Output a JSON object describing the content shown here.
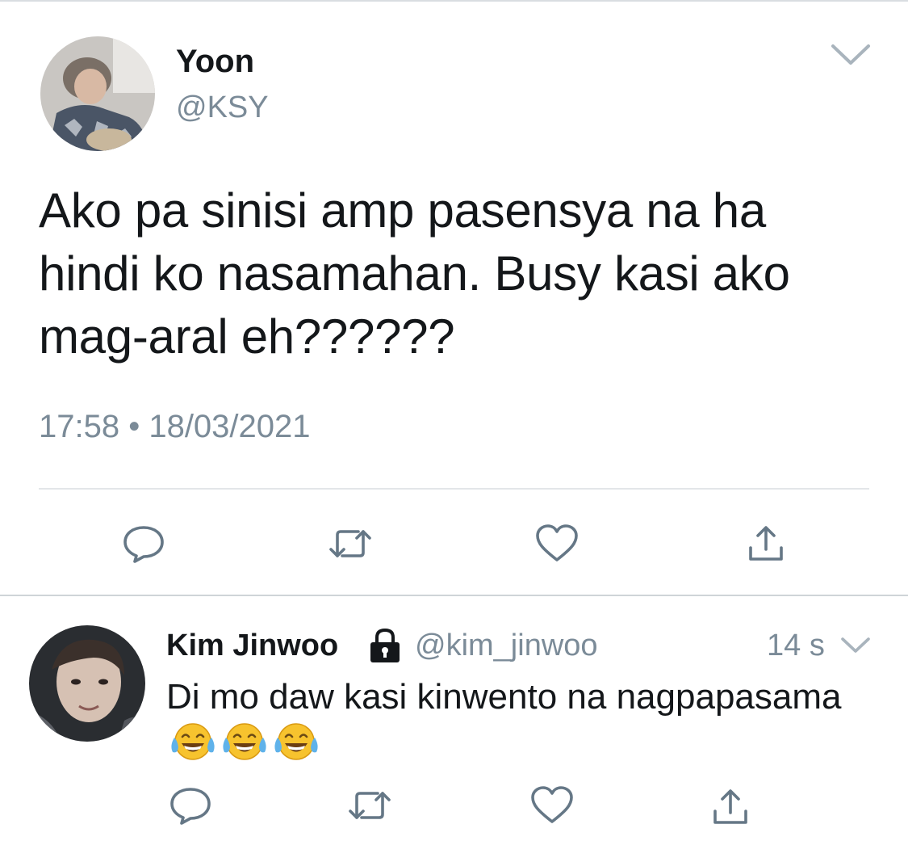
{
  "tweet": {
    "author_name": "Yoon",
    "author_handle": "@KSY",
    "text": "Ako pa sinisi amp pasensya na ha hindi ko nasamahan. Busy kasi ako mag-aral eh??????",
    "timestamp": "17:58 • 18/03/2021",
    "actions": [
      "reply-icon",
      "retweet-icon",
      "like-icon",
      "share-icon"
    ]
  },
  "reply": {
    "author_name": "Kim Jinwoo",
    "author_handle": "@kim_jinwoo",
    "time": "14 s",
    "text": "Di mo daw kasi kinwento na nagpapasama",
    "emoji": [
      "face-with-tears-of-joy",
      "face-with-tears-of-joy",
      "face-with-tears-of-joy"
    ],
    "actions": [
      "reply-icon",
      "retweet-icon",
      "like-icon",
      "share-icon"
    ]
  },
  "colors": {
    "text": "#14171a",
    "secondary": "#7b8b98",
    "icon": "#657786",
    "divider": "#e3e6e9"
  }
}
